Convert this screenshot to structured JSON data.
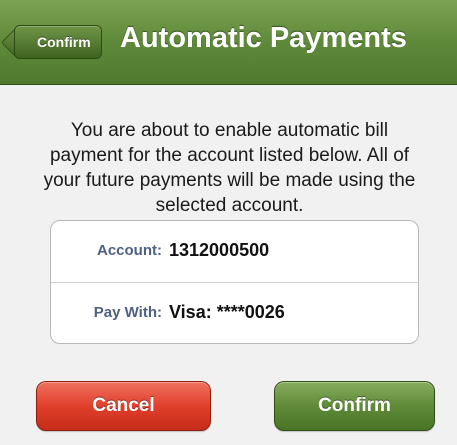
{
  "header": {
    "back_label": "Confirm",
    "title": "Automatic Payments"
  },
  "message": "You are about to enable automatic bill payment for the account listed below. All of your future payments will be made using the selected account.",
  "details": {
    "account_label": "Account:",
    "account_value": "1312000500",
    "pay_with_label": "Pay With:",
    "pay_with_value": "Visa: ****0026"
  },
  "actions": {
    "cancel_label": "Cancel",
    "confirm_label": "Confirm"
  },
  "colors": {
    "navbar_green": "#5f8a3a",
    "cancel_red": "#e0402c",
    "confirm_green": "#5f8a38",
    "label_blue": "#4f6183"
  }
}
